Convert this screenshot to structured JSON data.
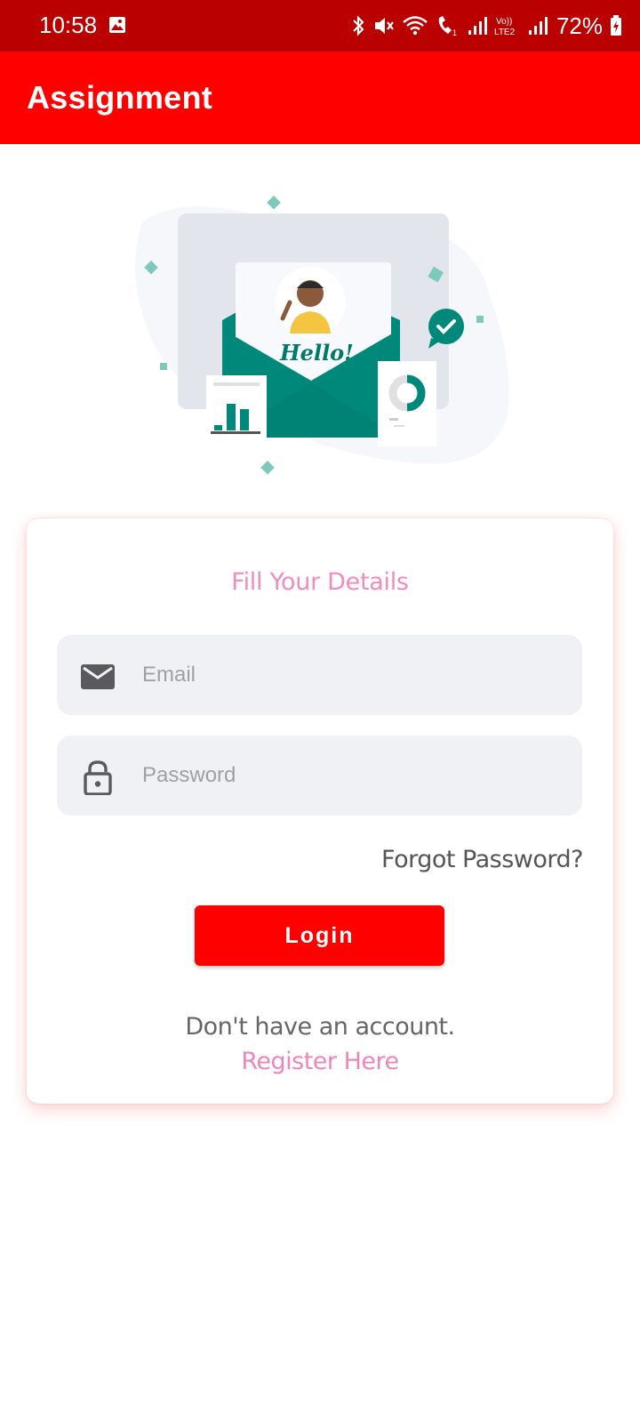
{
  "status_bar": {
    "time": "10:58",
    "battery": "72%",
    "icons": [
      "gallery-icon",
      "bluetooth-icon",
      "mute-icon",
      "wifi-icon",
      "wifi-call-icon",
      "signal-icon",
      "volte-icon",
      "signal-icon",
      "battery-charging-icon"
    ]
  },
  "app_bar": {
    "title": "Assignment",
    "color": "#ff0000"
  },
  "illustration": {
    "greeting": "Hello!",
    "accent_color": "#00897b"
  },
  "form": {
    "heading": "Fill Your Details",
    "email_placeholder": "Email",
    "email_value": "",
    "password_placeholder": "Password",
    "password_value": "",
    "forgot_label": "Forgot Password?",
    "login_label": "Login",
    "no_account_text": "Don't have an account.",
    "register_label": "Register Here",
    "heading_color": "#f08cc0"
  }
}
